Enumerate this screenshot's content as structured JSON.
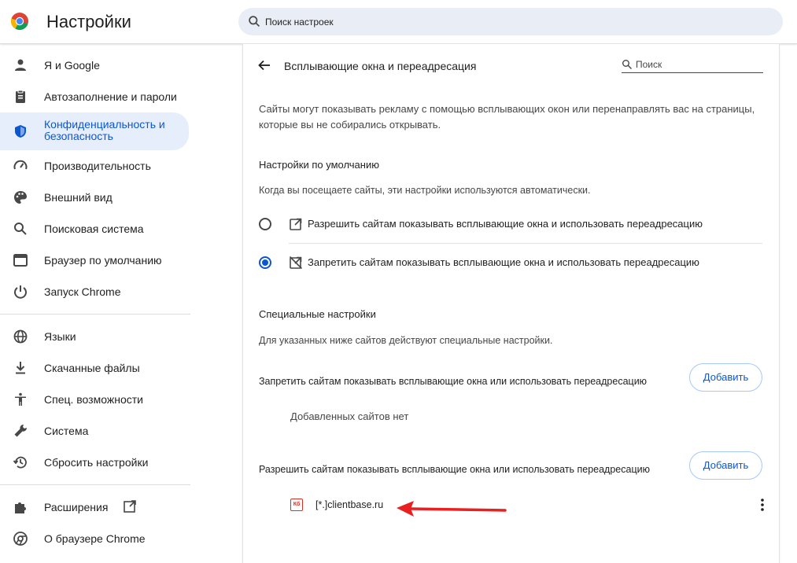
{
  "header": {
    "title": "Настройки",
    "search_placeholder": "Поиск настроек"
  },
  "sidebar": {
    "items": [
      {
        "label": "Я и Google",
        "icon": "person-icon"
      },
      {
        "label": "Автозаполнение и пароли",
        "icon": "clipboard-icon"
      },
      {
        "label": "Конфиденциальность и безопасность",
        "icon": "shield-icon",
        "active": true
      },
      {
        "label": "Производительность",
        "icon": "speedometer-icon"
      },
      {
        "label": "Внешний вид",
        "icon": "palette-icon"
      },
      {
        "label": "Поисковая система",
        "icon": "search-icon"
      },
      {
        "label": "Браузер по умолчанию",
        "icon": "browser-window-icon"
      },
      {
        "label": "Запуск Chrome",
        "icon": "power-icon"
      },
      {
        "label": "Языки",
        "icon": "globe-icon"
      },
      {
        "label": "Скачанные файлы",
        "icon": "download-icon"
      },
      {
        "label": "Спец. возможности",
        "icon": "accessibility-icon"
      },
      {
        "label": "Система",
        "icon": "wrench-icon"
      },
      {
        "label": "Сбросить настройки",
        "icon": "history-icon"
      },
      {
        "label": "Расширения",
        "icon": "puzzle-icon"
      },
      {
        "label": "О браузере Chrome",
        "icon": "chrome-icon"
      }
    ]
  },
  "page": {
    "title": "Всплывающие окна и переадресация",
    "search_placeholder": "Поиск",
    "description": "Сайты могут показывать рекламу с помощью всплывающих окон или перенаправлять вас на страницы, которые вы не собирались открывать.",
    "defaults": {
      "heading": "Настройки по умолчанию",
      "subtitle": "Когда вы посещаете сайты, эти настройки используются автоматически.",
      "options": [
        {
          "label": "Разрешить сайтам показывать всплывающие окна и использовать переадресацию",
          "checked": false
        },
        {
          "label": "Запретить сайтам показывать всплывающие окна и использовать переадресацию",
          "checked": true
        }
      ]
    },
    "custom": {
      "heading": "Специальные настройки",
      "subtitle": "Для указанных ниже сайтов действуют специальные настройки.",
      "block": {
        "label": "Запретить сайтам показывать всплывающие окна или использовать переадресацию",
        "button": "Добавить",
        "empty": "Добавленных сайтов нет"
      },
      "allow": {
        "label": "Разрешить сайтам показывать всплывающие окна или использовать переадресацию",
        "button": "Добавить",
        "sites": [
          {
            "favicon_text": "Кб",
            "name": "[*.]clientbase.ru"
          }
        ]
      }
    }
  },
  "colors": {
    "accent": "#0b57d0",
    "active_bg": "#e7eefb",
    "annotation_arrow": "#e8201f"
  }
}
